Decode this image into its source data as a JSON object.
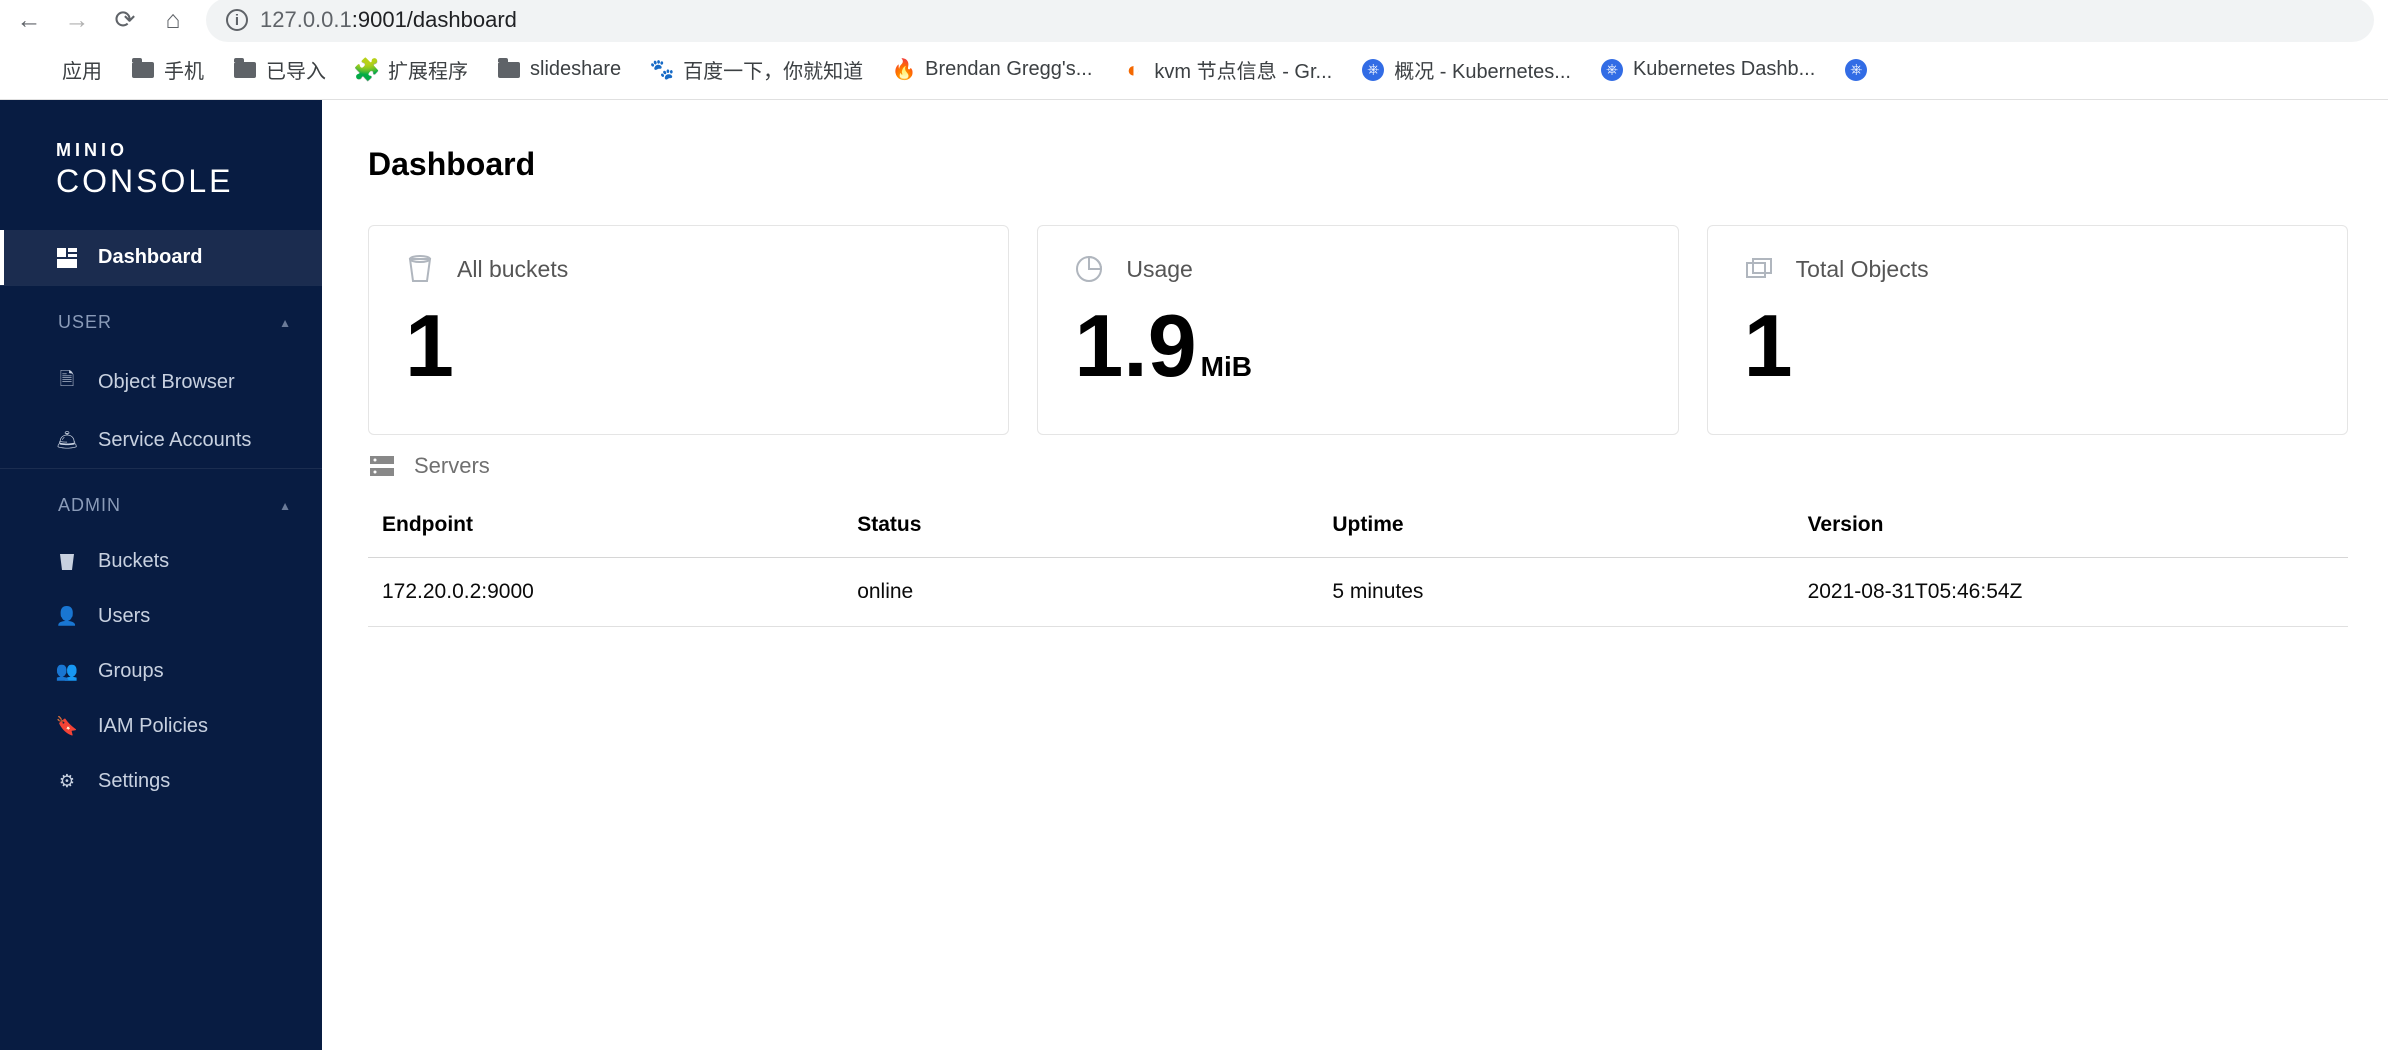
{
  "browser": {
    "url_prefix": "127.0.0.1",
    "url_suffix": ":9001/dashboard",
    "bookmarks": [
      {
        "label": "应用",
        "icon": "apps"
      },
      {
        "label": "手机",
        "icon": "folder"
      },
      {
        "label": "已导入",
        "icon": "folder"
      },
      {
        "label": "扩展程序",
        "icon": "puzzle"
      },
      {
        "label": "slideshare",
        "icon": "folder"
      },
      {
        "label": "百度一下，你就知道",
        "icon": "paw"
      },
      {
        "label": "Brendan Gregg's...",
        "icon": "flame"
      },
      {
        "label": "kvm 节点信息 - Gr...",
        "icon": "grafana"
      },
      {
        "label": "概况 - Kubernetes...",
        "icon": "k8s"
      },
      {
        "label": "Kubernetes Dashb...",
        "icon": "k8s"
      }
    ]
  },
  "sidebar": {
    "brand_line1": "MINIO",
    "brand_line2": "CONSOLE",
    "dashboard": "Dashboard",
    "sections": {
      "user": {
        "title": "USER",
        "items": [
          {
            "label": "Object Browser",
            "icon": "file"
          },
          {
            "label": "Service Accounts",
            "icon": "cloche"
          }
        ]
      },
      "admin": {
        "title": "ADMIN",
        "items": [
          {
            "label": "Buckets",
            "icon": "bucket"
          },
          {
            "label": "Users",
            "icon": "user"
          },
          {
            "label": "Groups",
            "icon": "users"
          },
          {
            "label": "IAM Policies",
            "icon": "bookmark"
          },
          {
            "label": "Settings",
            "icon": "gear"
          }
        ]
      }
    }
  },
  "page": {
    "title": "Dashboard"
  },
  "cards": {
    "buckets": {
      "label": "All buckets",
      "value": "1"
    },
    "usage": {
      "label": "Usage",
      "value": "1.9",
      "unit": "MiB"
    },
    "objects": {
      "label": "Total Objects",
      "value": "1"
    }
  },
  "servers": {
    "title": "Servers",
    "columns": {
      "endpoint": "Endpoint",
      "status": "Status",
      "uptime": "Uptime",
      "version": "Version"
    },
    "rows": [
      {
        "endpoint": "172.20.0.2:9000",
        "status": "online",
        "uptime": "5 minutes",
        "version": "2021-08-31T05:46:54Z"
      }
    ]
  }
}
